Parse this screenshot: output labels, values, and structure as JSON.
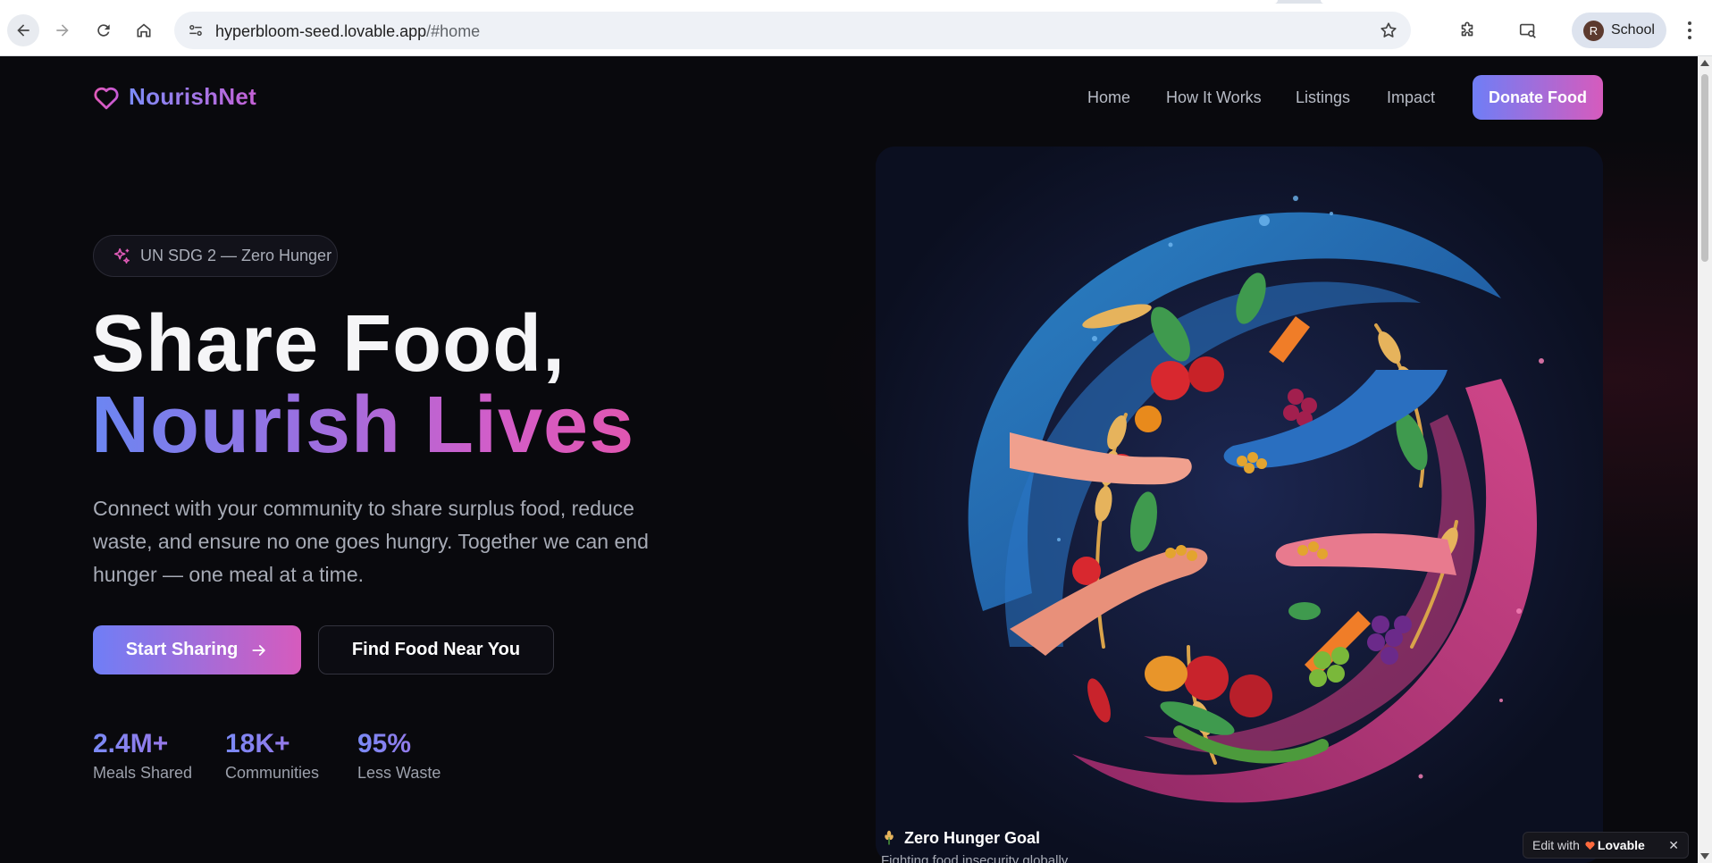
{
  "browser": {
    "url_host": "hyperbloom-seed.lovable.app",
    "url_path": "/#home",
    "profile_initial": "R",
    "profile_name": "School"
  },
  "site": {
    "brand": "NourishNet",
    "nav": [
      "Home",
      "How It Works",
      "Listings",
      "Impact"
    ],
    "cta_label": "Donate Food"
  },
  "hero": {
    "badge": "UN SDG 2 — Zero Hunger",
    "title_line1": "Share Food,",
    "title_line2": "Nourish Lives",
    "description": "Connect with your community to share surplus food, reduce waste, and ensure no one goes hungry. Together we can end hunger — one meal at a time.",
    "primary_button": "Start Sharing",
    "secondary_button": "Find Food Near You",
    "stats": [
      {
        "value": "2.4M+",
        "label": "Meals Shared"
      },
      {
        "value": "18K+",
        "label": "Communities"
      },
      {
        "value": "95%",
        "label": "Less Waste"
      }
    ]
  },
  "goal_card": {
    "title": "Zero Hunger Goal",
    "subtitle": "Fighting food insecurity globally"
  },
  "lovable_badge": {
    "prefix": "Edit with",
    "brand": "Lovable",
    "close": "✕"
  },
  "colors": {
    "accent_blue": "#6f7ef6",
    "accent_pink": "#d65bbd",
    "background": "#09090d"
  }
}
